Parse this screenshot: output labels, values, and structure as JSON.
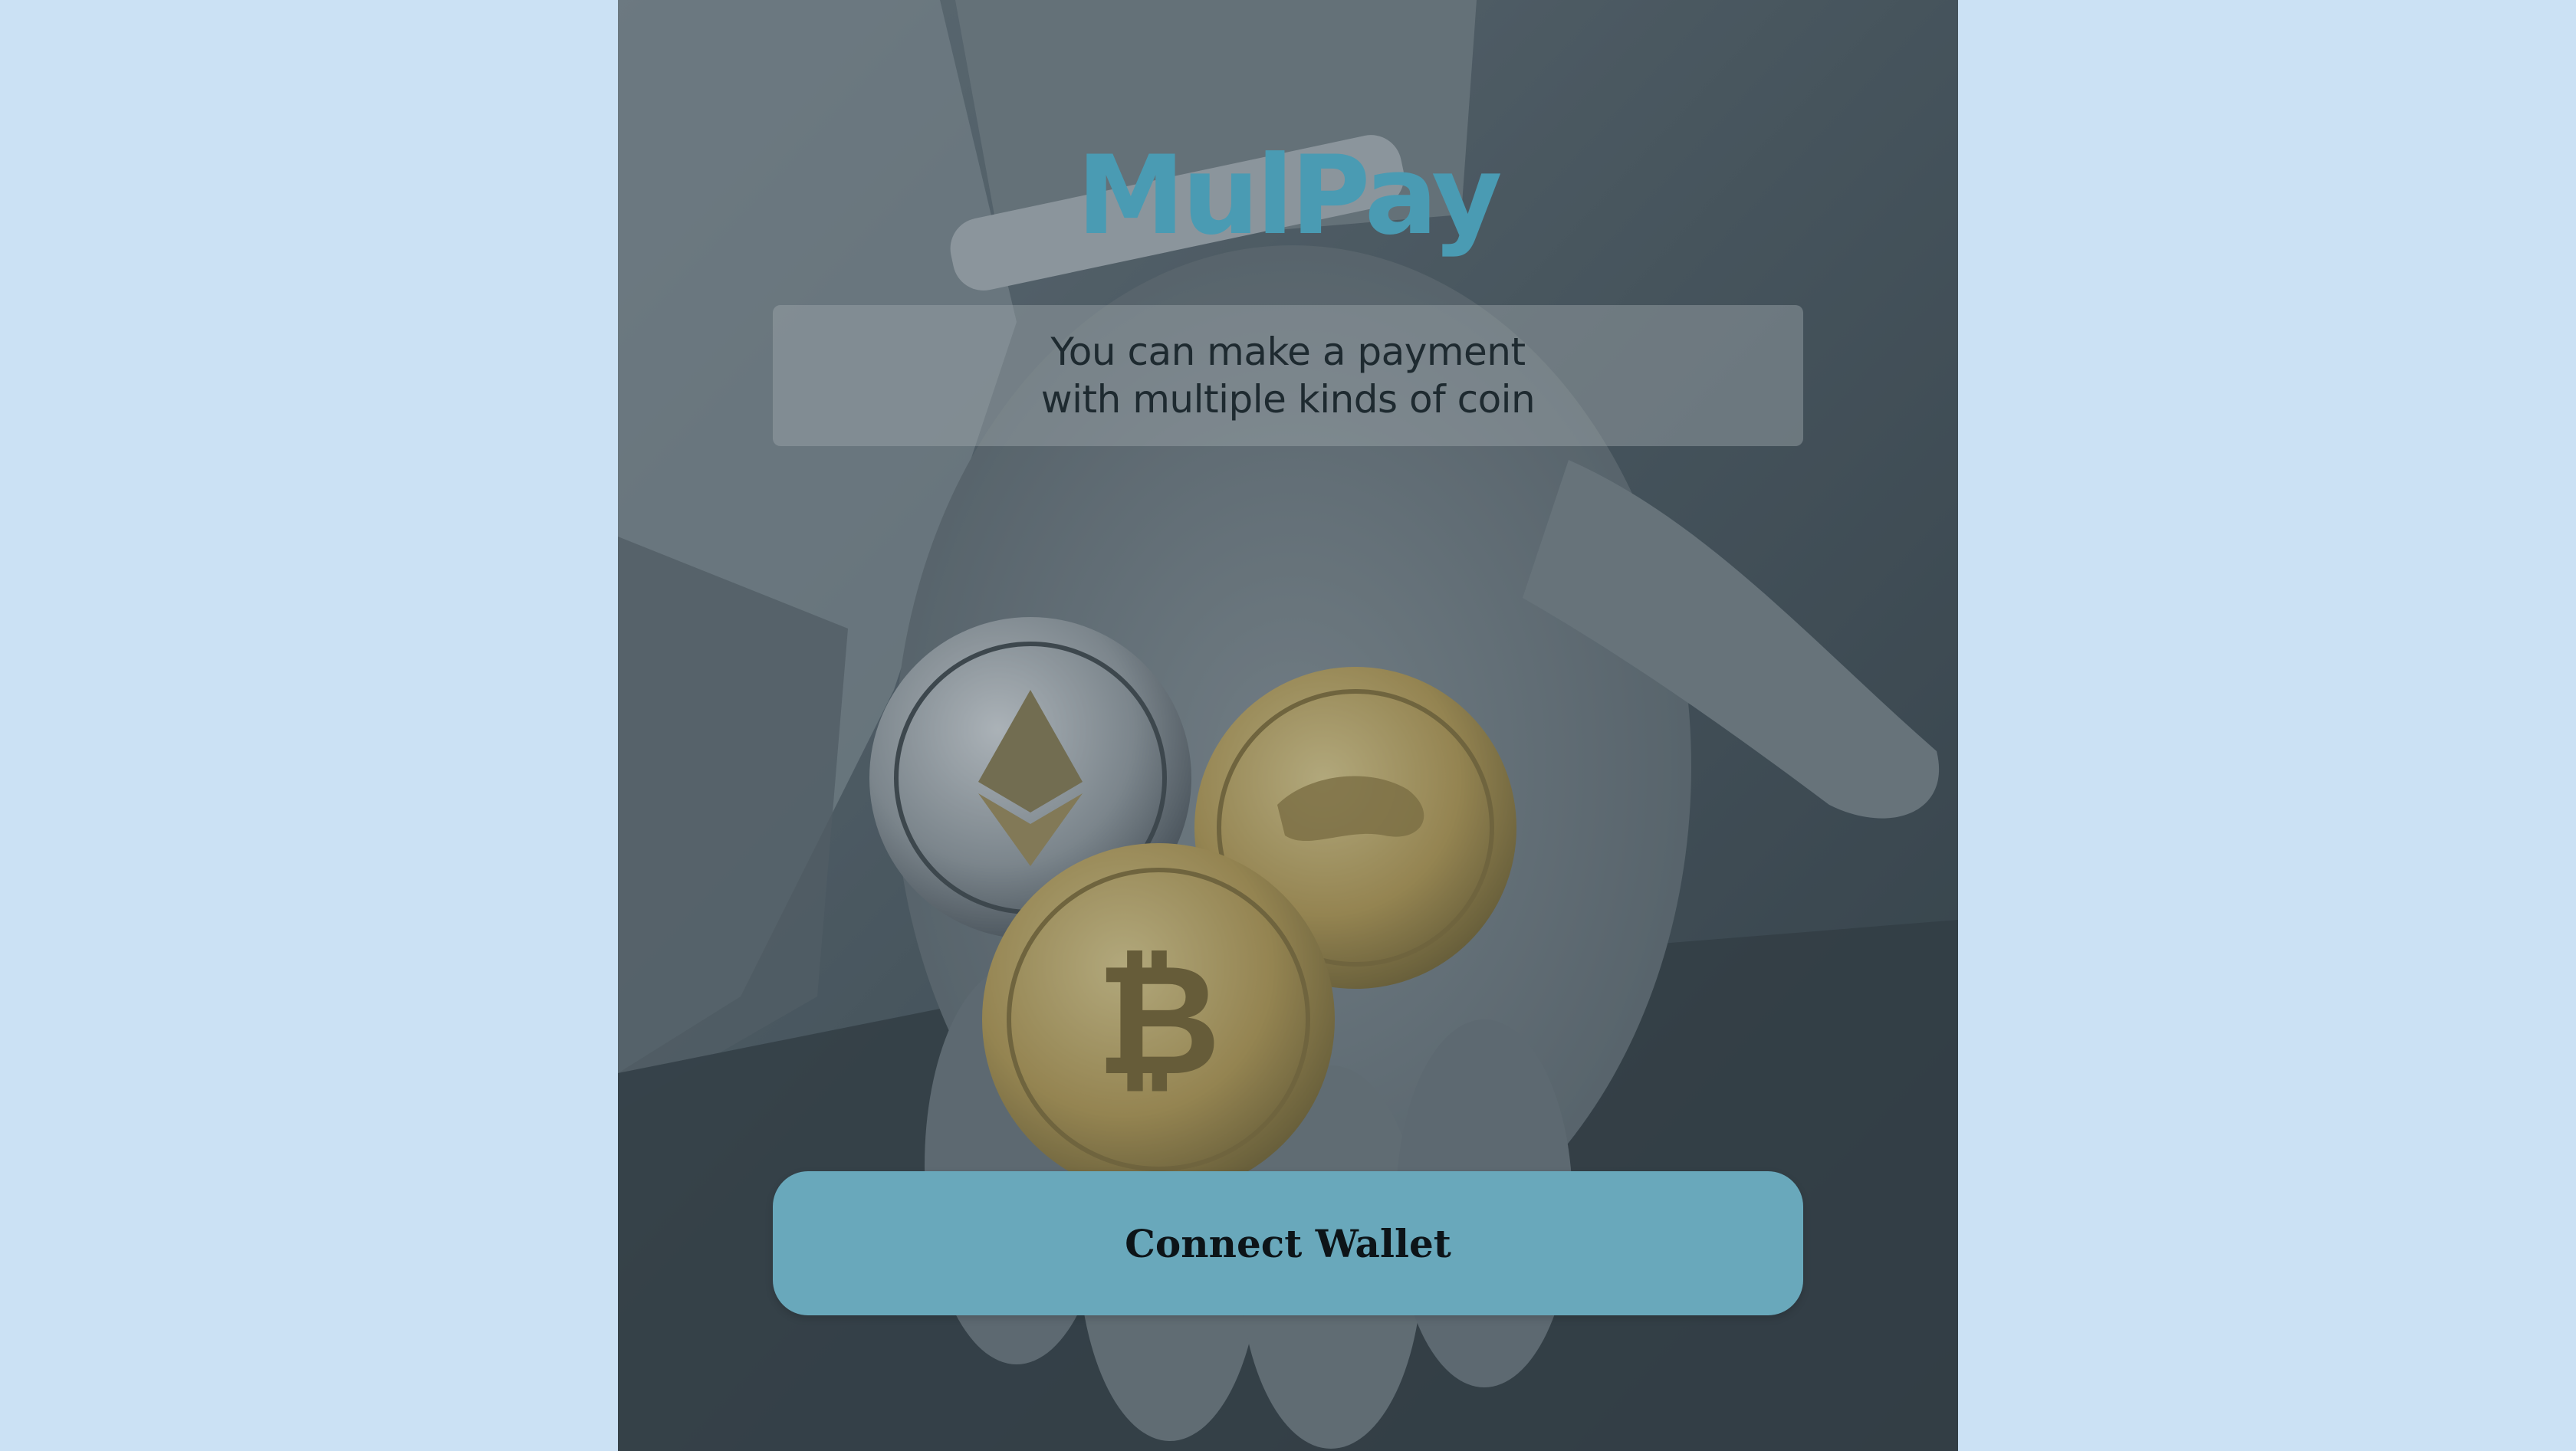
{
  "app": {
    "logo_text": "MulPay",
    "tagline_line1": "You can make a payment",
    "tagline_line2": "with multiple kinds of coin"
  },
  "actions": {
    "connect_label": "Connect Wallet"
  },
  "colors": {
    "page_background": "#cbe1f4",
    "logo": "#4a9bb3",
    "button": "#69a8bb"
  },
  "icons": {
    "coin_1": "ethereum-coin-icon",
    "coin_2": "ripple-coin-icon",
    "coin_3": "bitcoin-coin-icon"
  }
}
